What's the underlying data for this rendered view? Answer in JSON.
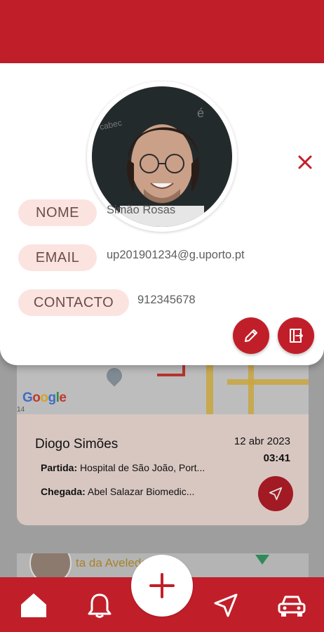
{
  "profile": {
    "fields": [
      {
        "label": "NOME",
        "value": "Simão Rosas"
      },
      {
        "label": "EMAIL",
        "value": "up201901234@g.uporto.pt"
      },
      {
        "label": "CONTACTO",
        "value": "912345678"
      }
    ],
    "close_icon": "close-icon",
    "edit_icon": "pencil-icon",
    "logout_icon": "logout-icon"
  },
  "map": {
    "logo": [
      "G",
      "o",
      "o",
      "g",
      "l",
      "e"
    ],
    "small_label": "14"
  },
  "trip": {
    "driver": "Diogo Simões",
    "date": "12 abr 2023",
    "time": "03:41",
    "start_label": "Partida:",
    "start_value": "Hospital de São João, Port...",
    "end_label": "Chegada:",
    "end_value": "Abel Salazar Biomedic..."
  },
  "feed2": {
    "place": "ta da Aveleda"
  },
  "nav": {
    "items": [
      "home-icon",
      "bell-icon",
      "navigation-icon",
      "car-icon"
    ],
    "fab_icon": "plus-icon"
  },
  "colors": {
    "accent": "#c01f2a",
    "tag_bg": "#fbe3df",
    "card_bg": "#fde8e2"
  }
}
